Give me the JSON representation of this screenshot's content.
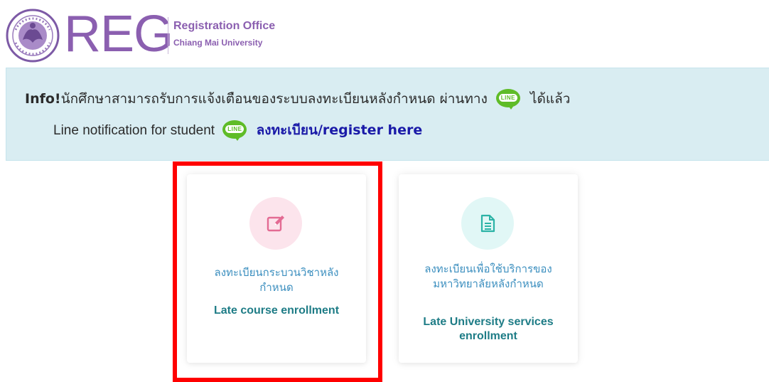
{
  "header": {
    "logo_text": "REG",
    "office_title": "Registration Office",
    "university": "Chiang Mai University"
  },
  "alert": {
    "label": "Info!",
    "message_before": "นักศึกษาสามารถรับการแจ้งเตือนของระบบลงทะเบียนหลังกำหนด ผ่านทาง",
    "message_after": "ได้แล้ว",
    "line2_text": "Line notification for student",
    "register_link": "ลงทะเบียน/register here",
    "line_badge": "LINE"
  },
  "cards": [
    {
      "icon": "edit-icon",
      "title_th": "ลงทะเบียนกระบวนวิชาหลังกำหนด",
      "title_en": "Late course enrollment"
    },
    {
      "icon": "document-icon",
      "title_th": "ลงทะเบียนเพื่อใช้บริการของมหาวิทยาลัยหลังกำหนด",
      "title_en": "Late University services enrollment"
    }
  ],
  "colors": {
    "brand_purple": "#8b5fb0",
    "alert_bg": "#d9edf2",
    "link_blue": "#1a1aa8",
    "card_th_text": "#3c8fbf",
    "card_en_text": "#1e7c86",
    "highlight": "#ff0000",
    "line_green": "#5fbc28"
  }
}
